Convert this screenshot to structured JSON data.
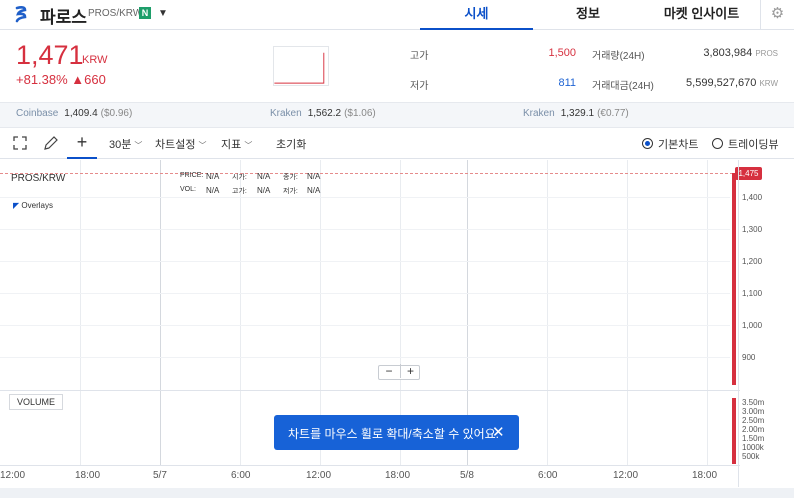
{
  "header": {
    "coin_name": "파로스",
    "pair": "PROS/KRW",
    "badge": "N",
    "caret": "▼",
    "tabs": [
      {
        "label": "시세",
        "active": true
      },
      {
        "label": "정보",
        "active": false
      },
      {
        "label": "마켓 인사이트",
        "active": false
      }
    ],
    "settings_icon": "gear-icon"
  },
  "summary": {
    "price": "1,471",
    "unit": "KRW",
    "change": "+81.38% ▲660",
    "high_label": "고가",
    "high_value": "1,500",
    "low_label": "저가",
    "low_value": "811",
    "volume_label": "거래량(24H)",
    "volume_value": "3,803,984",
    "volume_unit": "PROS",
    "amount_label": "거래대금(24H)",
    "amount_value": "5,599,527,670",
    "amount_unit": "KRW"
  },
  "exchanges": [
    {
      "name": "Coinbase",
      "value": "1,409.4",
      "diff": "($0.96)"
    },
    {
      "name": "Kraken",
      "value": "1,562.2",
      "diff": "($1.06)"
    },
    {
      "name": "Kraken",
      "value": "1,329.1",
      "diff": "(€0.77)"
    }
  ],
  "toolbar": {
    "interval": "30분",
    "chart_settings": "차트설정",
    "indicator": "지표",
    "reset": "초기화",
    "basic_chart": "기본차트",
    "tradingview": "트레이딩뷰",
    "caret": "﹀"
  },
  "chart": {
    "pair_label": "PROS/KRW",
    "overlays_label": "Overlays",
    "info_row1": [
      {
        "label": "PRICE:",
        "value": "N/A"
      },
      {
        "label": "시가:",
        "value": "N/A"
      },
      {
        "label": "종가:",
        "value": "N/A"
      }
    ],
    "info_row2": [
      {
        "label": "VOL:",
        "value": "N/A"
      },
      {
        "label": "고가:",
        "value": "N/A"
      },
      {
        "label": "저가:",
        "value": "N/A"
      }
    ],
    "current_price_tag": "1,475",
    "y_ticks": [
      "1,400",
      "1,300",
      "1,200",
      "1,100",
      "1,000",
      "900"
    ],
    "volume_label": "VOLUME",
    "volume_ticks": [
      "3.50m",
      "3.00m",
      "2.50m",
      "2.00m",
      "1.50m",
      "1000k",
      "500k"
    ],
    "x_ticks": [
      "12:00",
      "18:00",
      "5/7",
      "6:00",
      "12:00",
      "18:00",
      "5/8",
      "6:00",
      "12:00",
      "18:00"
    ],
    "zoom_minus": "−",
    "zoom_plus": "+"
  },
  "toast": {
    "text": "차트를 마우스 휠로 확대/축소할 수 있어요.",
    "close": "✕"
  }
}
